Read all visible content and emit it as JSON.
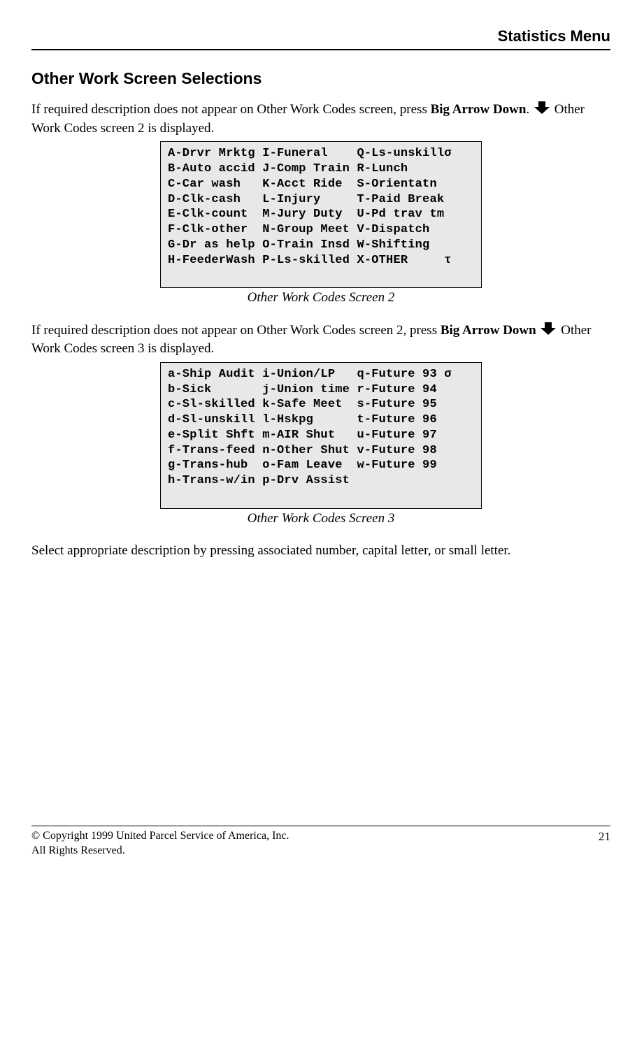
{
  "header": {
    "title": "Statistics Menu"
  },
  "section": {
    "heading": "Other Work Screen Selections"
  },
  "para1": {
    "part1": "If required description does not appear on Other Work Codes screen, press ",
    "bold1": "Big Arrow Down",
    "part2": ". ",
    "part3": " Other Work Codes screen 2 is displayed."
  },
  "screen2": {
    "lines": [
      "A-Drvr Mrktg I-Funeral    Q-Ls-unskillσ",
      "B-Auto accid J-Comp Train R-Lunch",
      "C-Car wash   K-Acct Ride  S-Orientatn",
      "D-Clk-cash   L-Injury     T-Paid Break",
      "E-Clk-count  M-Jury Duty  U-Pd trav tm",
      "F-Clk-other  N-Group Meet V-Dispatch",
      "G-Dr as help O-Train Insd W-Shifting",
      "H-FeederWash P-Ls-skilled X-OTHER     τ",
      "",
      ""
    ],
    "caption": "Other Work Codes Screen 2"
  },
  "para2": {
    "part1": "If required description does not appear on Other Work Codes screen 2, press ",
    "bold1": "Big Arrow Down",
    "part2": " ",
    "part3": " Other Work Codes screen 3 is displayed."
  },
  "screen3": {
    "lines": [
      "a-Ship Audit i-Union/LP   q-Future 93 σ",
      "b-Sick       j-Union time r-Future 94",
      "c-Sl-skilled k-Safe Meet  s-Future 95",
      "d-Sl-unskill l-Hskpg      t-Future 96",
      "e-Split Shft m-AIR Shut   u-Future 97",
      "f-Trans-feed n-Other Shut v-Future 98",
      "g-Trans-hub  o-Fam Leave  w-Future 99",
      "h-Trans-w/in p-Drv Assist",
      "",
      ""
    ],
    "caption": "Other Work Codes Screen 3"
  },
  "para3": "Select appropriate description by pressing associated number, capital letter, or small letter.",
  "footer": {
    "copyright": "© Copyright 1999 United Parcel Service of America, Inc.",
    "rights": "All Rights Reserved.",
    "pagenum": "21"
  }
}
